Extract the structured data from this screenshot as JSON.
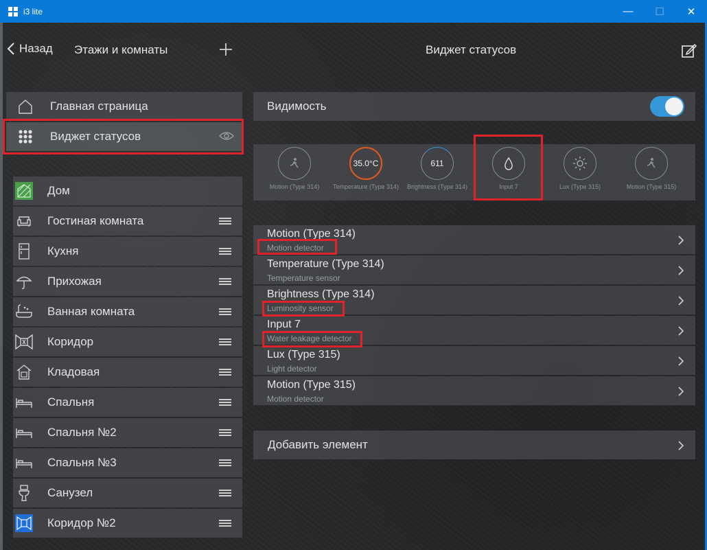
{
  "window": {
    "title": "i3 lite"
  },
  "header": {
    "back_label": "Назад",
    "floors_title": "Этажи и комнаты",
    "page_title": "Виджет статусов"
  },
  "nav": {
    "home_label": "Главная страница",
    "status_label": "Виджет статусов"
  },
  "rooms": [
    {
      "label": "Дом",
      "icon": "house-icon"
    },
    {
      "label": "Гостиная комната",
      "icon": "sofa-icon"
    },
    {
      "label": "Кухня",
      "icon": "fridge-icon"
    },
    {
      "label": "Прихожая",
      "icon": "umbrella-icon"
    },
    {
      "label": "Ванная комната",
      "icon": "bathtub-icon"
    },
    {
      "label": "Коридор",
      "icon": "corridor-icon"
    },
    {
      "label": "Кладовая",
      "icon": "storage-icon"
    },
    {
      "label": "Спальня",
      "icon": "bed-icon"
    },
    {
      "label": "Спальня №2",
      "icon": "bed-icon"
    },
    {
      "label": "Спальня №3",
      "icon": "bed-icon"
    },
    {
      "label": "Санузел",
      "icon": "toilet-icon"
    },
    {
      "label": "Коридор №2",
      "icon": "corridor-icon"
    }
  ],
  "visibility": {
    "label": "Видимость",
    "enabled": true
  },
  "widgets": [
    {
      "value": "",
      "label": "Motion (Type 314)",
      "icon": "motion-icon"
    },
    {
      "value": "35.0°C",
      "label": "Temperature (Type 314)",
      "icon": ""
    },
    {
      "value": "611",
      "label": "Brightness (Type 314)",
      "icon": ""
    },
    {
      "value": "",
      "label": "Input 7",
      "icon": "water-drop-icon"
    },
    {
      "value": "",
      "label": "Lux (Type 315)",
      "icon": "sun-icon"
    },
    {
      "value": "",
      "label": "Motion (Type 315)",
      "icon": "motion-icon"
    }
  ],
  "sensors": [
    {
      "name": "Motion (Type 314)",
      "desc": "Motion detector"
    },
    {
      "name": "Temperature (Type 314)",
      "desc": "Temperature sensor"
    },
    {
      "name": "Brightness (Type 314)",
      "desc": "Luminosity sensor"
    },
    {
      "name": "Input 7",
      "desc": "Water leakage detector"
    },
    {
      "name": "Lux (Type 315)",
      "desc": "Light detector"
    },
    {
      "name": "Motion (Type 315)",
      "desc": "Motion detector"
    }
  ],
  "add_element_label": "Добавить элемент",
  "colors": {
    "titlebar": "#0a7ad9",
    "toggle": "#3596d8",
    "highlight": "#e0232b",
    "temp_ring": "#e05a1e"
  }
}
